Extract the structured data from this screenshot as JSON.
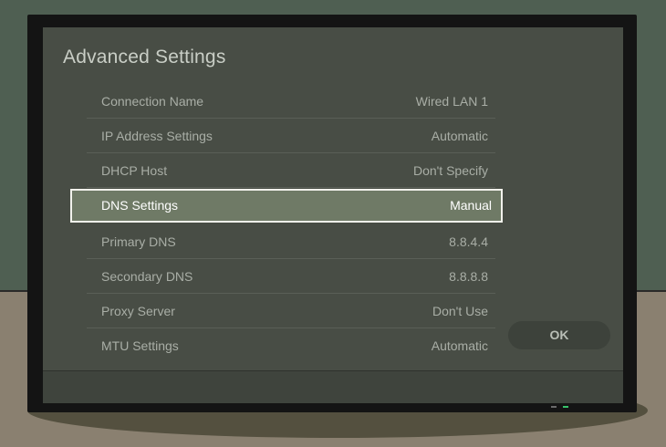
{
  "screen": {
    "title": "Advanced Settings",
    "settings": [
      {
        "label": "Connection Name",
        "value": "Wired LAN 1"
      },
      {
        "label": "IP Address Settings",
        "value": "Automatic"
      },
      {
        "label": "DHCP Host",
        "value": "Don't Specify"
      },
      {
        "label": "DNS Settings",
        "value": "Manual",
        "selected": true
      },
      {
        "label": "Primary DNS",
        "value": "8.8.4.4"
      },
      {
        "label": "Secondary DNS",
        "value": "8.8.8.8"
      },
      {
        "label": "Proxy Server",
        "value": "Don't Use"
      },
      {
        "label": "MTU Settings",
        "value": "Automatic"
      }
    ],
    "ok_label": "OK"
  },
  "colors": {
    "wall": "#4f5f52",
    "floor": "#8a8070",
    "screen_bg": "#484d45",
    "selected_bg": "#6f7a66",
    "power_led": "#38c26a"
  }
}
